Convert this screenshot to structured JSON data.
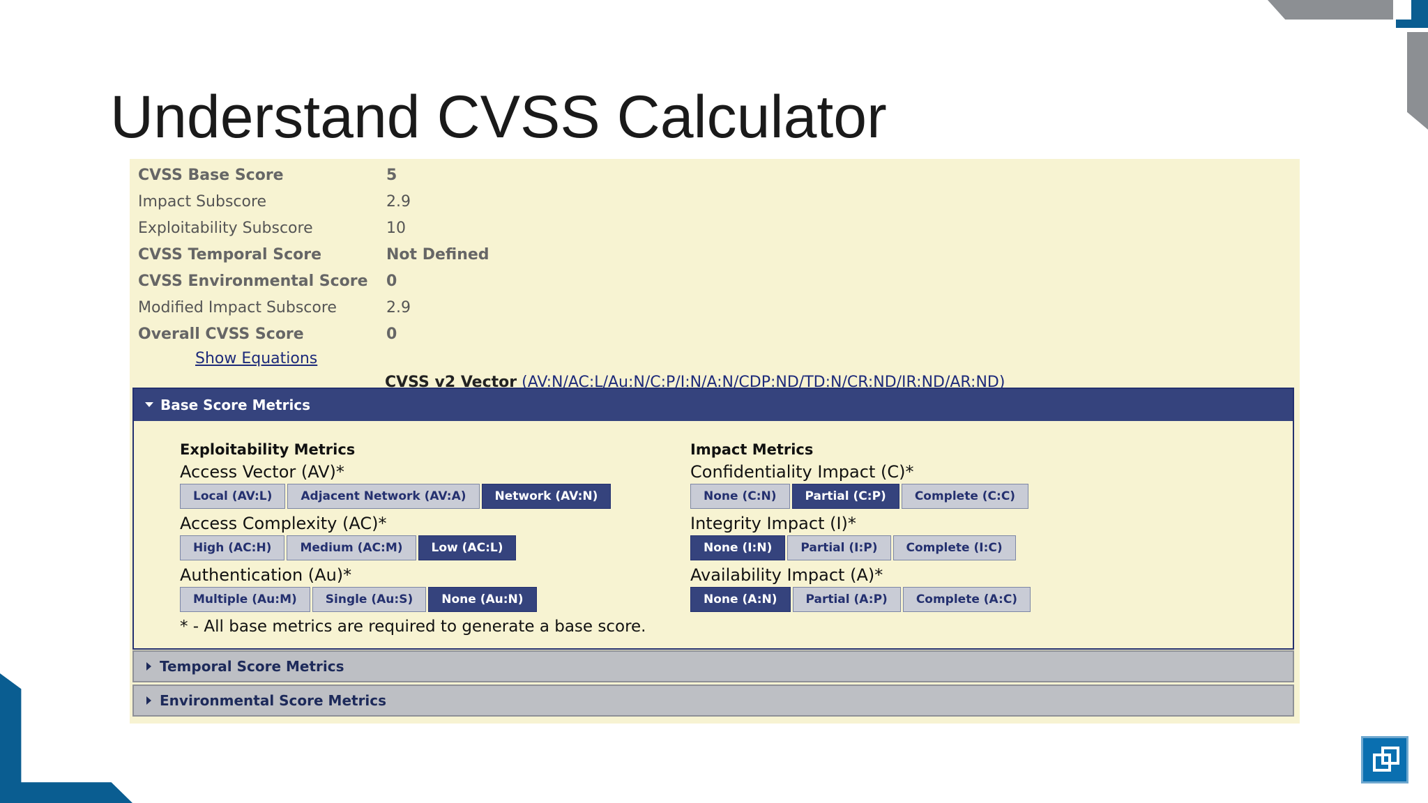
{
  "slide": {
    "title": "Understand CVSS Calculator"
  },
  "scores": [
    {
      "label": "CVSS Base Score",
      "value": "5",
      "bold": true
    },
    {
      "label": "Impact Subscore",
      "value": "2.9",
      "bold": false
    },
    {
      "label": "Exploitability Subscore",
      "value": "10",
      "bold": false
    },
    {
      "label": "CVSS Temporal Score",
      "value": "Not Defined",
      "bold": true
    },
    {
      "label": "CVSS Environmental Score",
      "value": "0",
      "bold": true
    },
    {
      "label": "Modified Impact Subscore",
      "value": "2.9",
      "bold": false
    },
    {
      "label": "Overall CVSS Score",
      "value": "0",
      "bold": true
    }
  ],
  "show_equations": "Show Equations",
  "vector": {
    "label": "CVSS v2 Vector",
    "value": "(AV:N/AC:L/Au:N/C:P/I:N/A:N/CDP:ND/TD:N/CR:ND/IR:ND/AR:ND)"
  },
  "base_section": {
    "title": "Base Score Metrics",
    "exploitability": {
      "title": "Exploitability Metrics",
      "metrics": [
        {
          "label": "Access Vector (AV)*",
          "options": [
            {
              "text": "Local (AV:L)",
              "selected": false
            },
            {
              "text": "Adjacent Network (AV:A)",
              "selected": false
            },
            {
              "text": "Network (AV:N)",
              "selected": true
            }
          ]
        },
        {
          "label": "Access Complexity (AC)*",
          "options": [
            {
              "text": "High (AC:H)",
              "selected": false
            },
            {
              "text": "Medium (AC:M)",
              "selected": false
            },
            {
              "text": "Low (AC:L)",
              "selected": true
            }
          ]
        },
        {
          "label": "Authentication (Au)*",
          "options": [
            {
              "text": "Multiple (Au:M)",
              "selected": false
            },
            {
              "text": "Single (Au:S)",
              "selected": false
            },
            {
              "text": "None (Au:N)",
              "selected": true
            }
          ]
        }
      ]
    },
    "impact": {
      "title": "Impact Metrics",
      "metrics": [
        {
          "label": "Confidentiality Impact (C)*",
          "options": [
            {
              "text": "None (C:N)",
              "selected": false
            },
            {
              "text": "Partial (C:P)",
              "selected": true
            },
            {
              "text": "Complete (C:C)",
              "selected": false
            }
          ]
        },
        {
          "label": "Integrity Impact (I)*",
          "options": [
            {
              "text": "None (I:N)",
              "selected": true
            },
            {
              "text": "Partial (I:P)",
              "selected": false
            },
            {
              "text": "Complete (I:C)",
              "selected": false
            }
          ]
        },
        {
          "label": "Availability Impact (A)*",
          "options": [
            {
              "text": "None (A:N)",
              "selected": true
            },
            {
              "text": "Partial (A:P)",
              "selected": false
            },
            {
              "text": "Complete (A:C)",
              "selected": false
            }
          ]
        }
      ]
    },
    "required_note": "* - All base metrics are required to generate a base score."
  },
  "temporal_section": {
    "title": "Temporal Score Metrics"
  },
  "environmental_section": {
    "title": "Environmental Score Metrics"
  },
  "colors": {
    "panel_bg": "#f7f3d2",
    "header_bg": "#35437d",
    "button_bg": "#c9ccd6",
    "button_selected_bg": "#35437d",
    "accent_blue": "#0a5d91"
  },
  "icons": {
    "expanded": "caret-down-icon",
    "collapsed": "caret-right-icon",
    "logo": "logo-icon"
  }
}
